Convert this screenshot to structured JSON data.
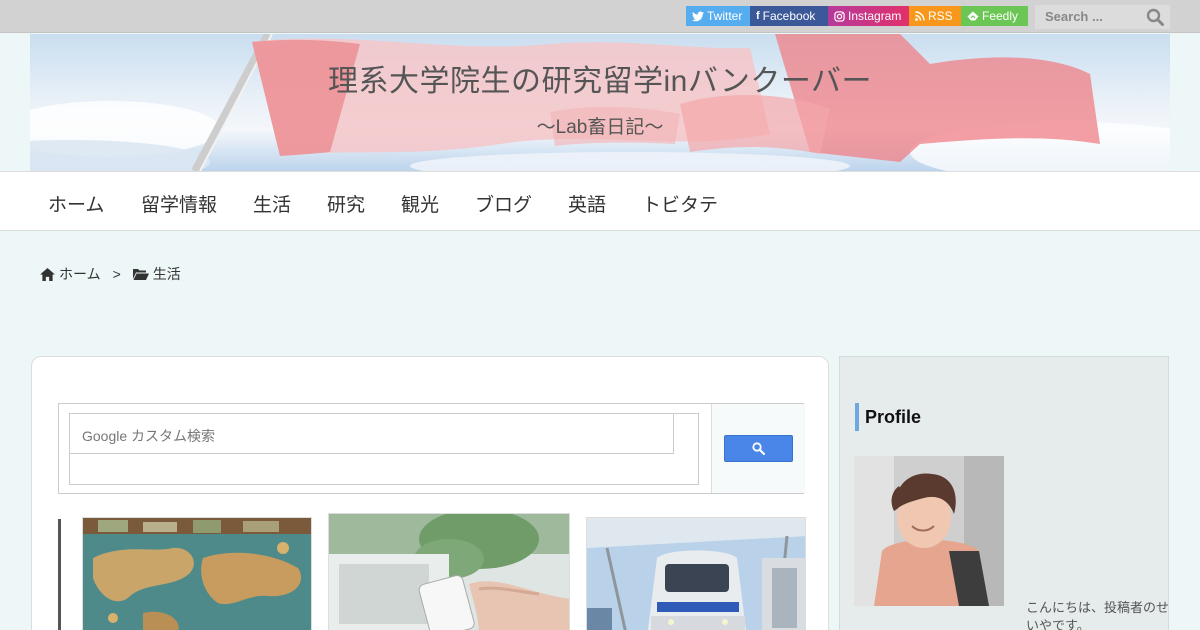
{
  "topbar": {
    "social": [
      {
        "label": "Twitter",
        "icon": "twitter-bird",
        "color": "#55acee"
      },
      {
        "label": "Facebook",
        "icon": "f",
        "color": "#3b5998"
      },
      {
        "label": "Instagram",
        "icon": "camera",
        "color": "#c13584"
      },
      {
        "label": "RSS",
        "icon": "rss",
        "color": "#f7981d"
      },
      {
        "label": "Feedly",
        "icon": "feedly-leaf",
        "color": "#6cc655"
      }
    ],
    "search_placeholder": "Search ..."
  },
  "header": {
    "title": "理系大学院生の研究留学inバンクーバー",
    "tagline": "～Lab畜日記～"
  },
  "nav": {
    "items": [
      "ホーム",
      "留学情報",
      "生活",
      "研究",
      "観光",
      "ブログ",
      "英語",
      "トビタテ"
    ]
  },
  "breadcrumb": {
    "home": "ホーム",
    "separator": ">",
    "current": "生活"
  },
  "main": {
    "search_placeholder": "Google カスタム検索"
  },
  "sidebar": {
    "heading": "Profile",
    "intro": "こんにちは、投稿者のせいやです。"
  }
}
